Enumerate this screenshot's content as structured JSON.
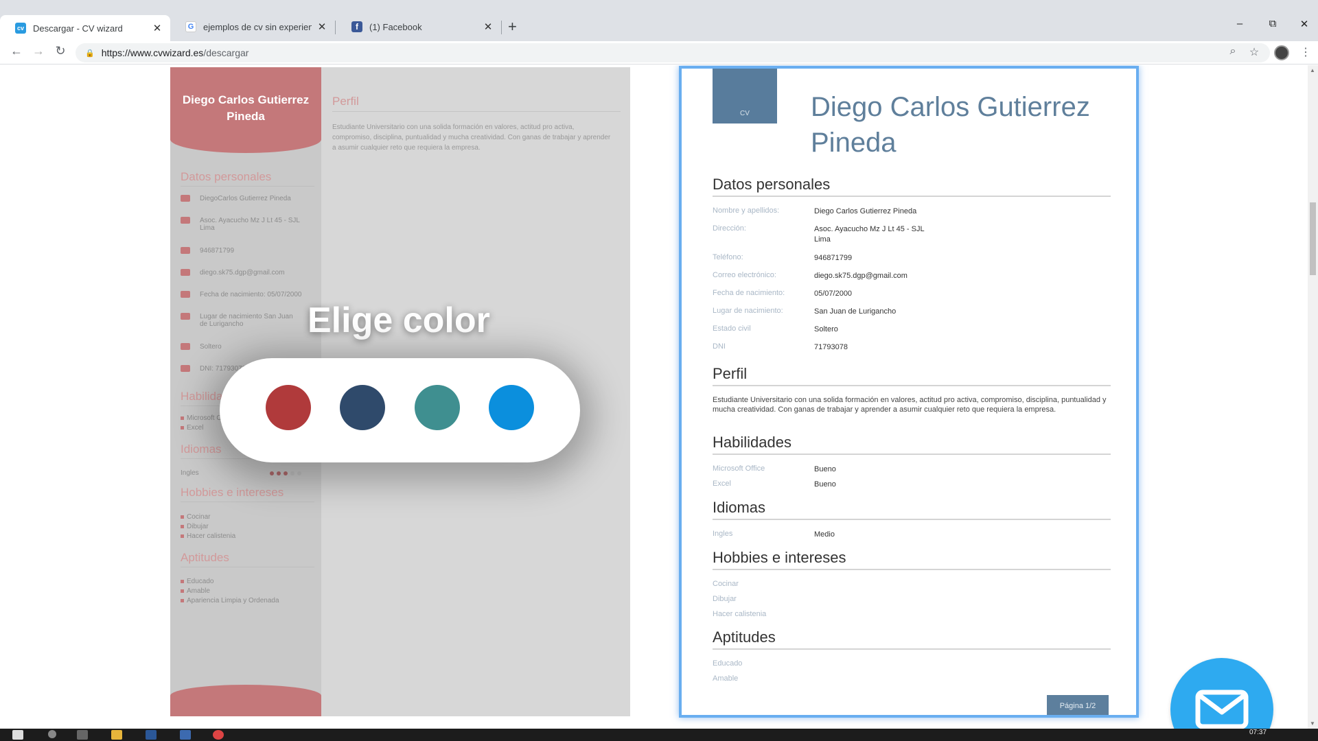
{
  "browser": {
    "tabs": [
      {
        "title": "Descargar - CV wizard",
        "favicon": "cv-icon",
        "active": true
      },
      {
        "title": "ejemplos de cv sin experiencia la",
        "favicon": "google-icon",
        "active": false
      },
      {
        "title": "(1) Facebook",
        "favicon": "facebook-icon",
        "active": false
      }
    ],
    "new_tab": "+",
    "url_host": "https://www.cvwizard.es",
    "url_path": "/descargar",
    "window_controls": {
      "minimize": "–",
      "restore": "⧉",
      "close": "✕"
    }
  },
  "left_cv": {
    "name": "Diego Carlos Gutierrez Pineda",
    "sections": {
      "personal": "Datos personales",
      "skills": "Habilidades",
      "languages": "Idiomas",
      "hobbies": "Hobbies e intereses",
      "aptitudes": "Aptitudes",
      "profile": "Perfil"
    },
    "personal_items": [
      "DiegoCarlos Gutierrez Pineda",
      "Asoc. Ayacucho Mz J Lt 45 - SJL Lima",
      "946871799",
      "diego.sk75.dgp@gmail.com",
      "Fecha de nacimiento: 05/07/2000",
      "Lugar de nacimiento San Juan de Lurigancho",
      "Soltero",
      "DNI: 71793078"
    ],
    "skills_items": [
      "Microsoft Office",
      "Excel"
    ],
    "language_item": "Ingles",
    "hobbies": [
      "Cocinar",
      "Dibujar",
      "Hacer calistenia"
    ],
    "aptitudes": [
      "Educado",
      "Amable",
      "Apariencia Limpia y Ordenada"
    ],
    "profile_text": "Estudiante Universitario con una solida formación en valores, actitud pro activa, compromiso, disciplina, puntualidad y mucha creatividad. Con ganas de trabajar y aprender a asumir cualquier reto que requiera la empresa."
  },
  "picker": {
    "title": "Elige color",
    "colors": [
      {
        "name": "red",
        "hex": "#b03a3b"
      },
      {
        "name": "navy",
        "hex": "#2f4a6b"
      },
      {
        "name": "teal",
        "hex": "#3f8f90"
      },
      {
        "name": "blue",
        "hex": "#0b8fdd"
      }
    ]
  },
  "right_cv": {
    "logo": "CV",
    "name": "Diego Carlos Gutierrez Pineda",
    "headings": {
      "personal": "Datos personales",
      "profile": "Perfil",
      "skills": "Habilidades",
      "languages": "Idiomas",
      "hobbies": "Hobbies e intereses",
      "aptitudes": "Aptitudes"
    },
    "personal": [
      {
        "label": "Nombre y apellidos:",
        "value": "Diego Carlos Gutierrez Pineda"
      },
      {
        "label": "Dirección:",
        "value": "Asoc. Ayacucho Mz J Lt 45 - SJL\nLima"
      },
      {
        "label": "Teléfono:",
        "value": "946871799"
      },
      {
        "label": "Correo electrónico:",
        "value": "diego.sk75.dgp@gmail.com"
      },
      {
        "label": "Fecha de nacimiento:",
        "value": "05/07/2000"
      },
      {
        "label": "Lugar de nacimiento:",
        "value": "San Juan de Lurigancho"
      },
      {
        "label": "Estado civil",
        "value": "Soltero"
      },
      {
        "label": "DNI",
        "value": "71793078"
      }
    ],
    "profile_text": "Estudiante Universitario con una solida formación en valores, actitud pro activa, compromiso, disciplina, puntualidad y mucha creatividad. Con ganas de trabajar y aprender a asumir cualquier reto que requiera la empresa.",
    "skills": [
      {
        "label": "Microsoft Office",
        "value": "Bueno"
      },
      {
        "label": "Excel",
        "value": "Bueno"
      }
    ],
    "languages": [
      {
        "label": "Ingles",
        "value": "Medio"
      }
    ],
    "hobbies": [
      "Cocinar",
      "Dibujar",
      "Hacer calistenia"
    ],
    "aptitudes": [
      "Educado",
      "Amable"
    ],
    "page_label": "Página 1/2"
  },
  "fab": {
    "icon": "mail-icon"
  },
  "taskbar": {
    "time": "07:37"
  }
}
